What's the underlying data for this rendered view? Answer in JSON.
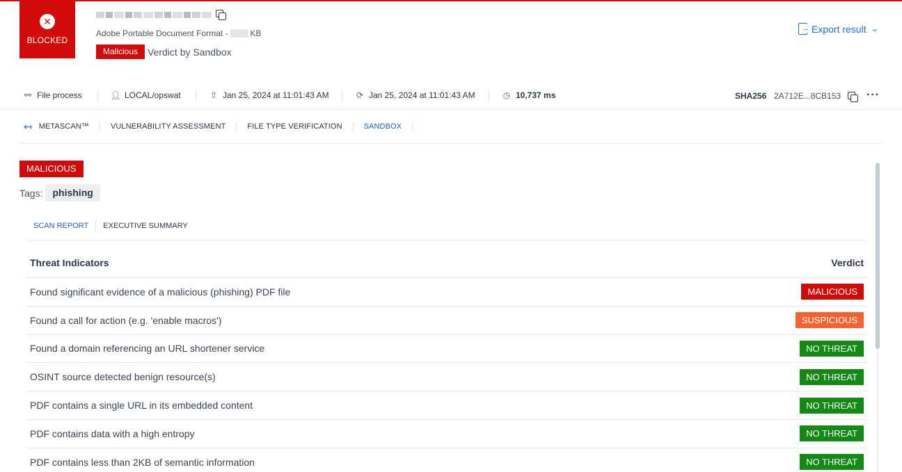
{
  "header": {
    "blocked_label": "BLOCKED",
    "file_type": "Adobe Portable Document Format - ",
    "file_size_unit": "KB",
    "verdict_badge": "Malicious",
    "verdict_by": "Verdict by Sandbox",
    "export_label": "Export result"
  },
  "info_bar": {
    "process": "File process",
    "user": "LOCAL/opswat",
    "uploaded": "Jan 25, 2024 at 11:01:43 AM",
    "processed": "Jan 25, 2024 at 11:01:43 AM",
    "duration": "10,737 ms",
    "sha_label": "SHA256",
    "sha_value": "2A712E...8CB153"
  },
  "engine_tabs": [
    {
      "label": "METASCAN™"
    },
    {
      "label": "VULNERABILITY ASSESSMENT"
    },
    {
      "label": "FILE TYPE VERIFICATION"
    },
    {
      "label": "SANDBOX"
    }
  ],
  "active_engine_tab": "SANDBOX",
  "result": {
    "verdict": "MALICIOUS",
    "tags_label": "Tags:",
    "tags": [
      "phishing"
    ]
  },
  "sub_tabs": [
    {
      "label": "SCAN REPORT"
    },
    {
      "label": "EXECUTIVE SUMMARY"
    }
  ],
  "table": {
    "col_indicator": "Threat Indicators",
    "col_verdict": "Verdict",
    "rows": [
      {
        "indicator": "Found significant evidence of a malicious (phishing) PDF file",
        "verdict": "MALICIOUS"
      },
      {
        "indicator": "Found a call for action (e.g. 'enable macros')",
        "verdict": "SUSPICIOUS"
      },
      {
        "indicator": "Found a domain referencing an URL shortener service",
        "verdict": "NO THREAT"
      },
      {
        "indicator": "OSINT source detected benign resource(s)",
        "verdict": "NO THREAT"
      },
      {
        "indicator": "PDF contains a single URL in its embedded content",
        "verdict": "NO THREAT"
      },
      {
        "indicator": "PDF contains data with a high entropy",
        "verdict": "NO THREAT"
      },
      {
        "indicator": "PDF contains less than 2KB of semantic information",
        "verdict": "NO THREAT"
      }
    ]
  },
  "colors": {
    "malicious": "#d10a0a",
    "suspicious": "#f5622e",
    "no_threat": "#138a14",
    "accent": "#1d6fd8"
  }
}
